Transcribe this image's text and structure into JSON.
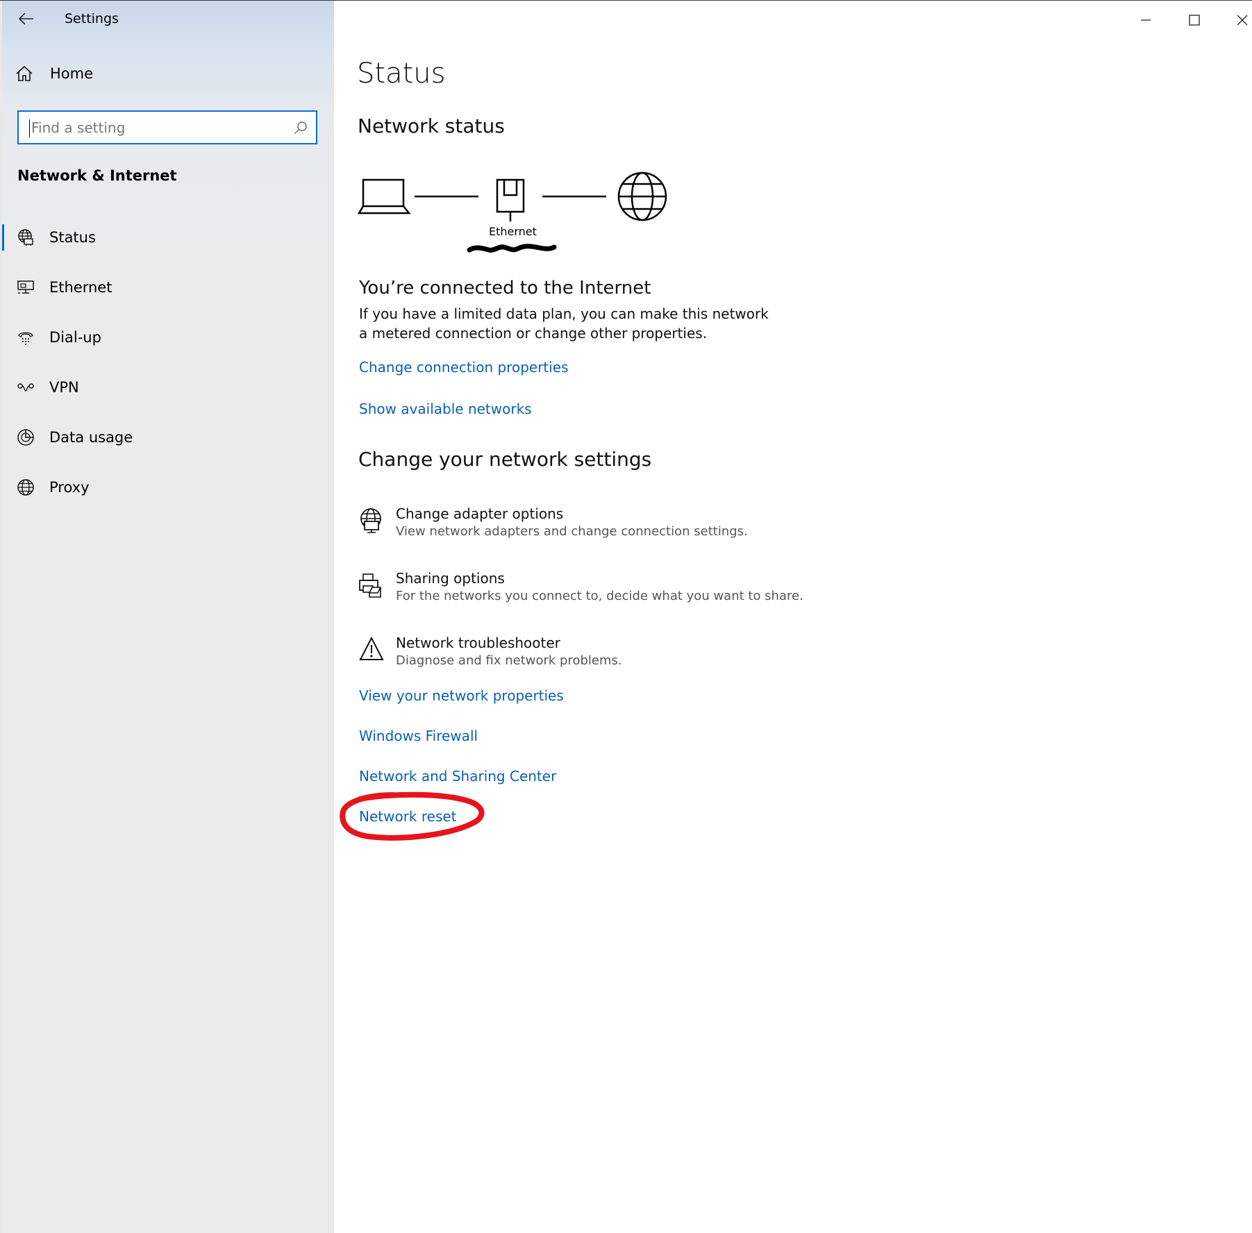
{
  "window": {
    "title": "Settings",
    "controls": {
      "minimize": "minimize-icon",
      "maximize": "maximize-icon",
      "close": "close-icon"
    }
  },
  "sidebar": {
    "home_label": "Home",
    "search": {
      "placeholder": "Find a setting"
    },
    "section_title": "Network & Internet",
    "items": [
      {
        "label": "Status",
        "icon": "status-globe-icon",
        "active": true
      },
      {
        "label": "Ethernet",
        "icon": "ethernet-icon",
        "active": false
      },
      {
        "label": "Dial-up",
        "icon": "dialup-icon",
        "active": false
      },
      {
        "label": "VPN",
        "icon": "vpn-icon",
        "active": false
      },
      {
        "label": "Data usage",
        "icon": "data-usage-icon",
        "active": false
      },
      {
        "label": "Proxy",
        "icon": "proxy-globe-icon",
        "active": false
      }
    ]
  },
  "main": {
    "page_title": "Status",
    "network_status_heading": "Network status",
    "diagram": {
      "adapter_label": "Ethernet"
    },
    "connected_heading": "You’re connected to the Internet",
    "connected_desc": "If you have a limited data plan, you can make this network a metered connection or change other properties.",
    "links_top": [
      "Change connection properties",
      "Show available networks"
    ],
    "change_heading": "Change your network settings",
    "options": [
      {
        "title": "Change adapter options",
        "desc": "View network adapters and change connection settings.",
        "icon": "adapter-icon"
      },
      {
        "title": "Sharing options",
        "desc": "For the networks you connect to, decide what you want to share.",
        "icon": "sharing-icon"
      },
      {
        "title": "Network troubleshooter",
        "desc": "Diagnose and fix network problems.",
        "icon": "warning-icon"
      }
    ],
    "links_bottom": [
      "View your network properties",
      "Windows Firewall",
      "Network and Sharing Center",
      "Network reset"
    ]
  },
  "colors": {
    "accent": "#0c6ccf",
    "link": "#0a5fb4",
    "annotation": "#e8141b"
  }
}
